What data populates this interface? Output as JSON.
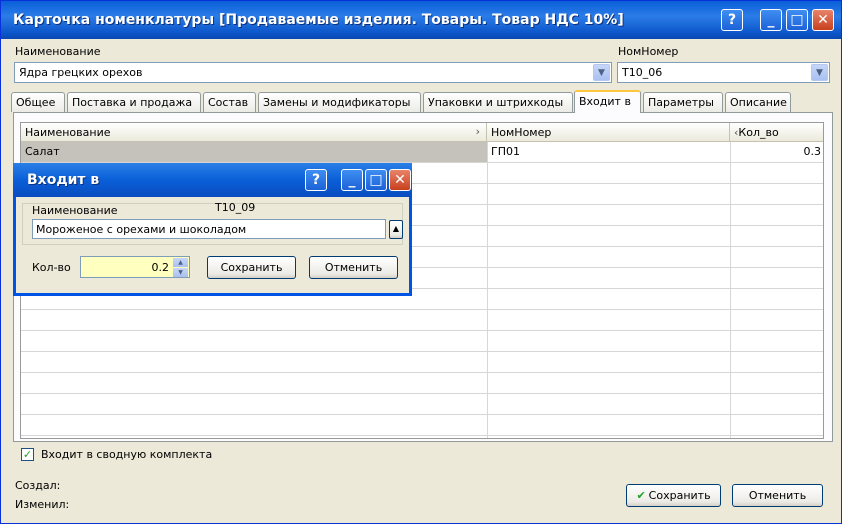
{
  "window": {
    "title": "Карточка номенклатуры [Продаваемые изделия. Товары. Товар НДС 10%]",
    "buttons": {
      "help": "?",
      "minimize": "_",
      "maximize": "□",
      "close": "✕"
    }
  },
  "header": {
    "name_label": "Наименование",
    "name_value": "Ядра грецких орехов",
    "code_label": "НомНомер",
    "code_value": "Т10_06"
  },
  "tabs": [
    {
      "label": "Общее"
    },
    {
      "label": "Поставка и продажа"
    },
    {
      "label": "Состав"
    },
    {
      "label": "Замены и модификаторы"
    },
    {
      "label": "Упаковки и штрихкоды"
    },
    {
      "label": "Входит в",
      "active": true
    },
    {
      "label": "Параметры"
    },
    {
      "label": "Описание"
    }
  ],
  "grid": {
    "columns": [
      "Наименование",
      "НомНомер",
      "Кол_во"
    ],
    "rows": [
      {
        "name": "Салат",
        "code": "ГП01",
        "qty": "0.3"
      }
    ]
  },
  "checkbox": {
    "label": "Входит в сводную комплекта",
    "checked": true
  },
  "footer": {
    "created_label": "Создал:",
    "modified_label": "Изменил:",
    "save_label": "Сохранить",
    "cancel_label": "Отменить"
  },
  "dialog": {
    "title": "Входит в",
    "name_label": "Наименование",
    "code_value": "Т10_09",
    "name_value": "Мороженое с орехами и шоколадом",
    "qty_label": "Кол-во",
    "qty_value": "0.2",
    "save_label": "Сохранить",
    "cancel_label": "Отменить"
  },
  "colors": {
    "titlebar": "#0a5fd8",
    "accent_tab": "#ffc83c",
    "input_highlight": "#ffffc0",
    "selected_row": "#c4c2bb"
  }
}
